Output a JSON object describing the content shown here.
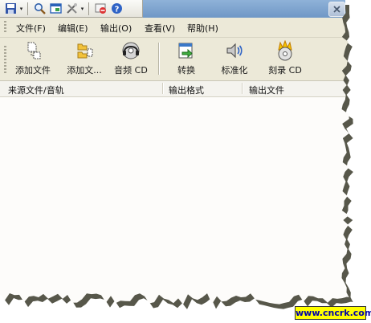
{
  "quick_access": {
    "icons": [
      "save-icon",
      "search-icon",
      "window-icon",
      "tools-icon",
      "stop-icon",
      "help-icon"
    ]
  },
  "menu": {
    "items": [
      {
        "label": "文件(F)"
      },
      {
        "label": "编辑(E)"
      },
      {
        "label": "输出(O)"
      },
      {
        "label": "查看(V)"
      },
      {
        "label": "帮助(H)"
      }
    ]
  },
  "toolbar": {
    "buttons": [
      {
        "label": "添加文件",
        "icon": "add-file-icon"
      },
      {
        "label": "添加文...",
        "icon": "add-folder-icon"
      },
      {
        "label": "音频 CD",
        "icon": "audio-cd-icon"
      },
      {
        "label": "转换",
        "icon": "convert-icon"
      },
      {
        "label": "标准化",
        "icon": "normalize-icon"
      },
      {
        "label": "刻录 CD",
        "icon": "burn-cd-icon"
      }
    ]
  },
  "list": {
    "columns": [
      {
        "label": "来源文件/音轨"
      },
      {
        "label": "输出格式"
      },
      {
        "label": "输出文件"
      }
    ],
    "rows": []
  },
  "watermark": {
    "text": "www.cncrk.com"
  },
  "colors": {
    "titlebar": "#7aa0cc",
    "chrome": "#ece9d8",
    "watermark_bg": "#ffff00",
    "watermark_fg": "#0000aa"
  }
}
